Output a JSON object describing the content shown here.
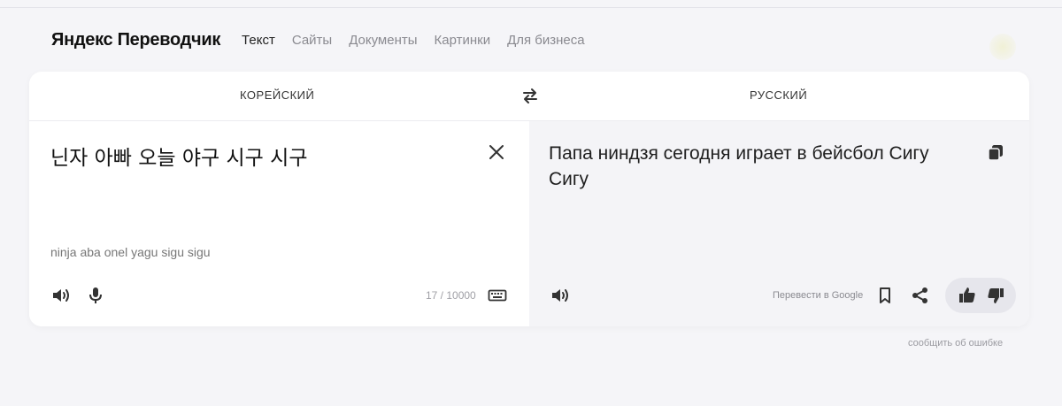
{
  "header": {
    "logo": "Яндекс Переводчик",
    "nav": [
      {
        "label": "Текст",
        "active": true
      },
      {
        "label": "Сайты",
        "active": false
      },
      {
        "label": "Документы",
        "active": false
      },
      {
        "label": "Картинки",
        "active": false
      },
      {
        "label": "Для бизнеса",
        "active": false
      }
    ]
  },
  "languages": {
    "source": "КОРЕЙСКИЙ",
    "target": "РУССКИЙ",
    "swap_icon": "swap-arrows-icon"
  },
  "source": {
    "text": "닌자 아빠 오늘 야구 시구 시구",
    "transliteration": "ninja aba onel yagu sigu sigu",
    "counter": "17 / 10000",
    "icons": [
      "speaker-icon",
      "microphone-icon",
      "keyboard-icon",
      "close-icon"
    ]
  },
  "target": {
    "text": "Папа ниндзя сегодня играет в бейсбол Сигу Сигу",
    "google_link": "Перевести в Google",
    "icons": [
      "copy-icon",
      "speaker-icon",
      "bookmark-icon",
      "share-icon",
      "thumb-up-icon",
      "thumb-down-icon"
    ]
  },
  "footer": {
    "report": "сообщить об ошибке"
  },
  "colors": {
    "background": "#f5f5f8",
    "card": "#ffffff",
    "target_pane": "#f4f4f7",
    "text": "#1e1e1e",
    "muted": "#8a8a90"
  }
}
